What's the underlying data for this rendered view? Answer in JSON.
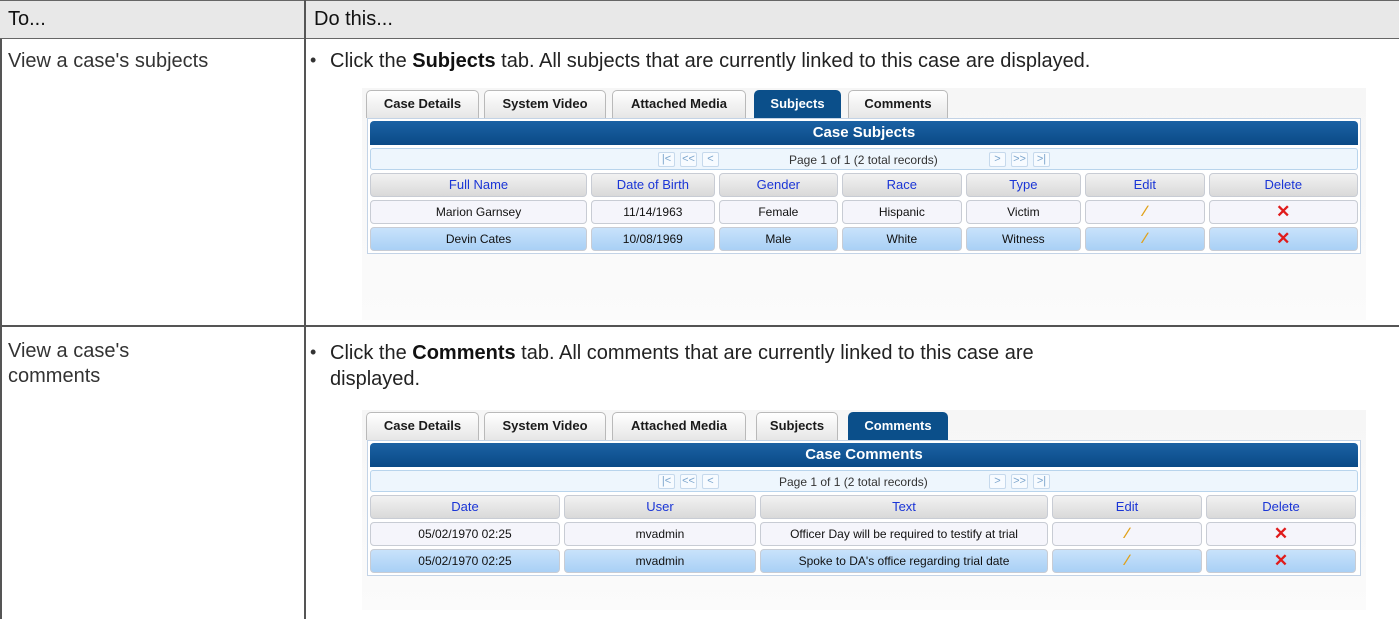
{
  "header": {
    "col1": "To...",
    "col2": "Do this..."
  },
  "rows": [
    {
      "task": "View a case's subjects",
      "bullet": "•",
      "instruction_pre": "Click the ",
      "instruction_bold": "Subjects",
      "instruction_post": " tab. All subjects that are currently linked to this case are displayed.",
      "screenshot": {
        "tabs": [
          "Case Details",
          "System Video",
          "Attached Media",
          "Subjects",
          "Comments"
        ],
        "active_tab": "Subjects",
        "grid_title": "Case Subjects",
        "pager": {
          "first": "|<",
          "prev_page": "<<",
          "prev": "<",
          "text": "Page 1 of 1 (2 total records)",
          "next": ">",
          "next_page": ">>",
          "last": ">|"
        },
        "columns": [
          "Full Name",
          "Date of Birth",
          "Gender",
          "Race",
          "Type",
          "Edit",
          "Delete"
        ],
        "records": [
          [
            "Marion Garnsey",
            "11/14/1963",
            "Female",
            "Hispanic",
            "Victim"
          ],
          [
            "Devin Cates",
            "10/08/1969",
            "Male",
            "White",
            "Witness"
          ]
        ]
      }
    },
    {
      "task_line1": "View a case's",
      "task_line2": "comments",
      "bullet": "•",
      "instruction_pre": "Click the ",
      "instruction_bold": "Comments",
      "instruction_post": " tab. All comments that are currently linked to this case are",
      "instruction_line2": "displayed.",
      "screenshot": {
        "tabs": [
          "Case Details",
          "System Video",
          "Attached Media",
          "Subjects",
          "Comments"
        ],
        "active_tab": "Comments",
        "grid_title": "Case Comments",
        "pager": {
          "first": "|<",
          "prev_page": "<<",
          "prev": "<",
          "text": "Page 1 of 1 (2 total records)",
          "next": ">",
          "next_page": ">>",
          "last": ">|"
        },
        "columns": [
          "Date",
          "User",
          "Text",
          "Edit",
          "Delete"
        ],
        "records": [
          [
            "05/02/1970 02:25",
            "mvadmin",
            "Officer Day will be required to testify at trial"
          ],
          [
            "05/02/1970 02:25",
            "mvadmin",
            "Spoke to DA's office regarding trial date"
          ]
        ]
      }
    }
  ],
  "icons": {
    "edit": "pencil-icon",
    "delete": "x-icon",
    "edit_glyph": "∕",
    "delete_glyph": "✕",
    "edit_color": "#e0a11a",
    "delete_color": "#e01b1b",
    "active_tab_color": "#0b4f8a"
  }
}
